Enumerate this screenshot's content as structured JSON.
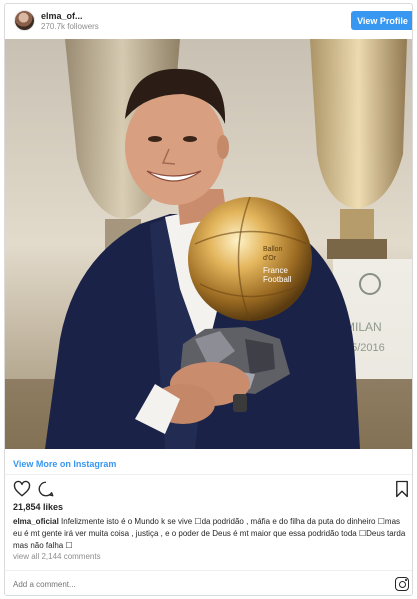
{
  "header": {
    "username": "elma_of...",
    "followers": "270.7k followers",
    "view_profile_label": "View Profile"
  },
  "photo": {
    "alt": "Cristiano Ronaldo holding the Ballon d'Or trophy",
    "trophy_text_lines": [
      "Ballon",
      "d'Or",
      "France",
      "Football"
    ],
    "banner_text": "MILAN",
    "banner_date": "05/2016"
  },
  "links": {
    "view_more": "View More on Instagram"
  },
  "icons": {
    "like": "heart-icon",
    "comment": "comment-icon",
    "save": "bookmark-icon",
    "brand": "instagram-icon"
  },
  "stats": {
    "likes": "21,854 likes"
  },
  "caption": {
    "user": "elma_oficial",
    "text": " Infelizmente isto é o Mundo k se vive ☐da podridão , máfia e do filha da puta do dinheiro ☐mas eu é mt gente irá ver muita coisa , justiça , e o poder de Deus é mt maior que essa podridão toda ☐Deus tarda mas não falha ☐"
  },
  "comments": {
    "view_all": "view all 2,144 comments"
  },
  "comment_input": {
    "placeholder": "Add a comment..."
  },
  "colors": {
    "accent": "#3897f0",
    "text": "#262626",
    "muted": "#8e8e8e",
    "border": "#dbdbdb"
  }
}
